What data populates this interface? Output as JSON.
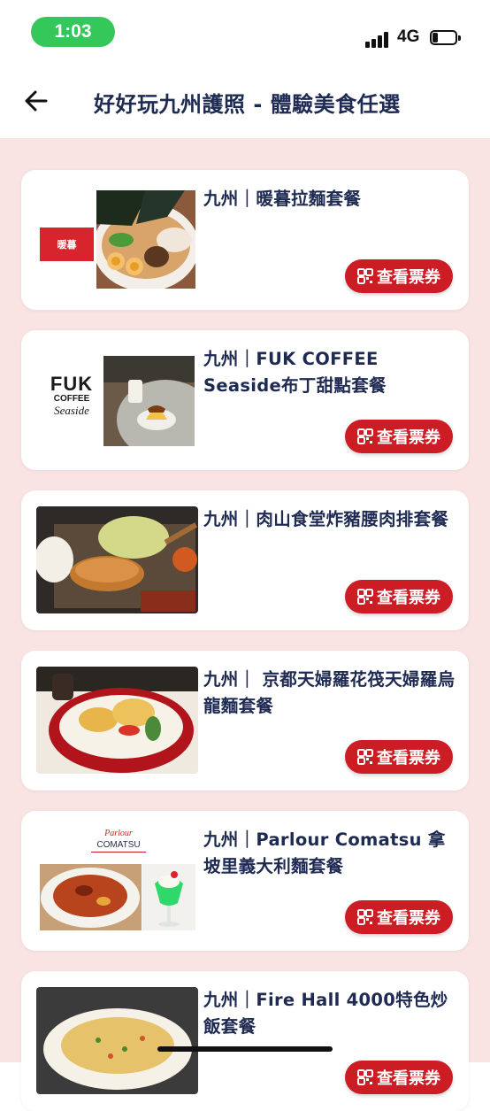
{
  "status_bar": {
    "time": "1:03",
    "network": "4G",
    "battery_level": 0.25
  },
  "nav": {
    "title": "好好玩九州護照 - 體驗美食任選"
  },
  "ticket_label": "查看票券",
  "cards": [
    {
      "title": "九州｜暖暮拉麵套餐",
      "logo_text": "暖暮"
    },
    {
      "title": "九州｜FUK COFFEE Seaside布丁甜點套餐",
      "logo_text": "FUK",
      "logo_sub1": "COFFEE",
      "logo_sub2": "Seaside"
    },
    {
      "title": "九州｜肉山食堂炸豬腰肉排套餐"
    },
    {
      "title": "九州｜ 京都天婦羅花筏天婦羅烏龍麵套餐"
    },
    {
      "title": "九州｜Parlour Comatsu 拿坡里義大利麵套餐",
      "logo_text": "COMATSU",
      "logo_script": "Parlour"
    },
    {
      "title": "九州｜Fire Hall 4000特色炒飯套餐"
    }
  ],
  "colors": {
    "accent": "#cc1c24",
    "title": "#1e2a52",
    "background": "#fae3e3",
    "status_green": "#34c759"
  },
  "icons": {
    "back": "arrow-left-icon",
    "ticket": "qr-code-icon"
  }
}
